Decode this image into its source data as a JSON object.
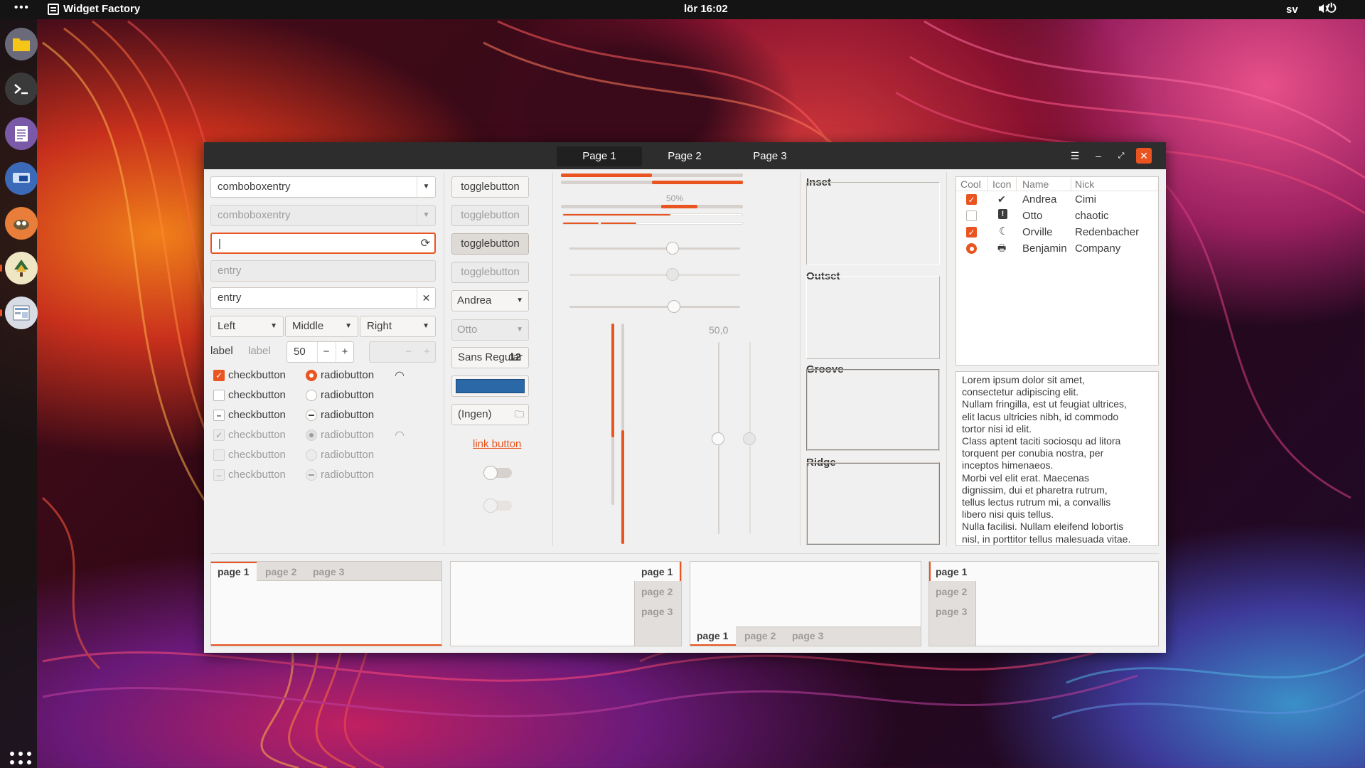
{
  "topbar": {
    "activities": "•••",
    "app_title": "Widget Factory",
    "clock": "lör 16:02",
    "lang": "sv"
  },
  "window": {
    "tabs": [
      "Page 1",
      "Page 2",
      "Page 3"
    ],
    "active_tab": 0
  },
  "col1": {
    "combo1": "comboboxentry",
    "combo2": "comboboxentry",
    "entry_focus": "|",
    "entry_dis": "entry",
    "entry_clear": "entry",
    "combo_left": "Left",
    "combo_middle": "Middle",
    "combo_right": "Right",
    "label1": "label",
    "label2": "label",
    "spin_value": "50",
    "checks": [
      {
        "label": "checkbutton",
        "state": "checked",
        "disabled": false
      },
      {
        "label": "checkbutton",
        "state": "unchecked",
        "disabled": false
      },
      {
        "label": "checkbutton",
        "state": "mixed",
        "disabled": false
      },
      {
        "label": "checkbutton",
        "state": "checked",
        "disabled": true
      },
      {
        "label": "checkbutton",
        "state": "unchecked",
        "disabled": true
      },
      {
        "label": "checkbutton",
        "state": "mixed",
        "disabled": true
      }
    ],
    "radios": [
      {
        "label": "radiobutton",
        "state": "checked",
        "disabled": false
      },
      {
        "label": "radiobutton",
        "state": "unchecked",
        "disabled": false
      },
      {
        "label": "radiobutton",
        "state": "mixed",
        "disabled": false
      },
      {
        "label": "radiobutton",
        "state": "checked",
        "disabled": true
      },
      {
        "label": "radiobutton",
        "state": "unchecked",
        "disabled": true
      },
      {
        "label": "radiobutton",
        "state": "mixed",
        "disabled": true
      }
    ]
  },
  "col2": {
    "toggle1": "togglebutton",
    "toggle2": "togglebutton",
    "toggle3": "togglebutton",
    "toggle4": "togglebutton",
    "combo_andrea": "Andrea",
    "combo_otto": "Otto",
    "font_name": "Sans Regular",
    "font_size": "12",
    "color_hex": "#2a68a8",
    "file_chooser": "(Ingen)",
    "link_button": "link button"
  },
  "col3": {
    "progress_label": "50%",
    "scale_value": "50,0"
  },
  "frames": {
    "inset": "Inset",
    "outset": "Outset",
    "groove": "Groove",
    "ridge": "Ridge"
  },
  "tree": {
    "headers": [
      "Cool",
      "Icon",
      "Name",
      "Nick"
    ],
    "rows": [
      {
        "cool": "checked",
        "icon": "check-circle-icon",
        "name": "Andrea",
        "nick": "Cimi"
      },
      {
        "cool": "unchecked",
        "icon": "warning-icon",
        "name": "Otto",
        "nick": "chaotic"
      },
      {
        "cool": "checked",
        "icon": "moon-icon",
        "name": "Orville",
        "nick": "Redenbacher"
      },
      {
        "cool": "radio",
        "icon": "printer-icon",
        "name": "Benjamin",
        "nick": "Company"
      }
    ]
  },
  "textview": {
    "lines": [
      "Lorem ipsum dolor sit amet,",
      "consectetur adipiscing elit.",
      "Nullam fringilla, est ut feugiat ultrices,",
      "elit lacus ultricies nibh, id commodo",
      "tortor nisi id elit.",
      "Class aptent taciti sociosqu ad litora",
      "torquent per conubia nostra, per",
      "inceptos himenaeos.",
      "Morbi vel elit erat. Maecenas",
      "dignissim, dui et pharetra rutrum,",
      "tellus lectus rutrum mi, a convallis",
      "libero nisi quis tellus.",
      "Nulla facilisi. Nullam eleifend lobortis",
      "nisl, in porttitor tellus malesuada vitae."
    ]
  },
  "notebooks": {
    "tabs": [
      "page 1",
      "page 2",
      "page 3"
    ]
  },
  "colors": {
    "accent": "#e95420",
    "titlebar": "#2d2d2d"
  }
}
